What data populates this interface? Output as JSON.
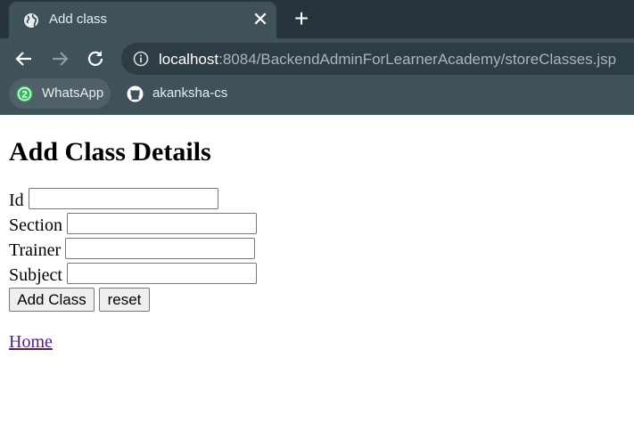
{
  "browser": {
    "tab": {
      "title": "Add class",
      "close": "✕"
    },
    "new_tab": "+",
    "address": {
      "host": "localhost",
      "rest": ":8084/BackendAdminForLearnerAcademy/storeClasses.jsp"
    },
    "bookmarks": [
      {
        "label": "WhatsApp",
        "icon": "whatsapp-icon",
        "badge": "2"
      },
      {
        "label": "akanksha-cs",
        "icon": "github-icon"
      }
    ]
  },
  "page": {
    "heading": "Add Class Details",
    "fields": [
      {
        "label": "Id",
        "value": ""
      },
      {
        "label": "Section",
        "value": ""
      },
      {
        "label": "Trainer",
        "value": ""
      },
      {
        "label": "Subject",
        "value": ""
      }
    ],
    "submit_label": "Add Class",
    "reset_label": "reset",
    "home_link": "Home"
  },
  "colors": {
    "chrome_dark": "#27343b",
    "chrome_toolbar": "#3f5159",
    "link_visited": "#551a8b"
  }
}
